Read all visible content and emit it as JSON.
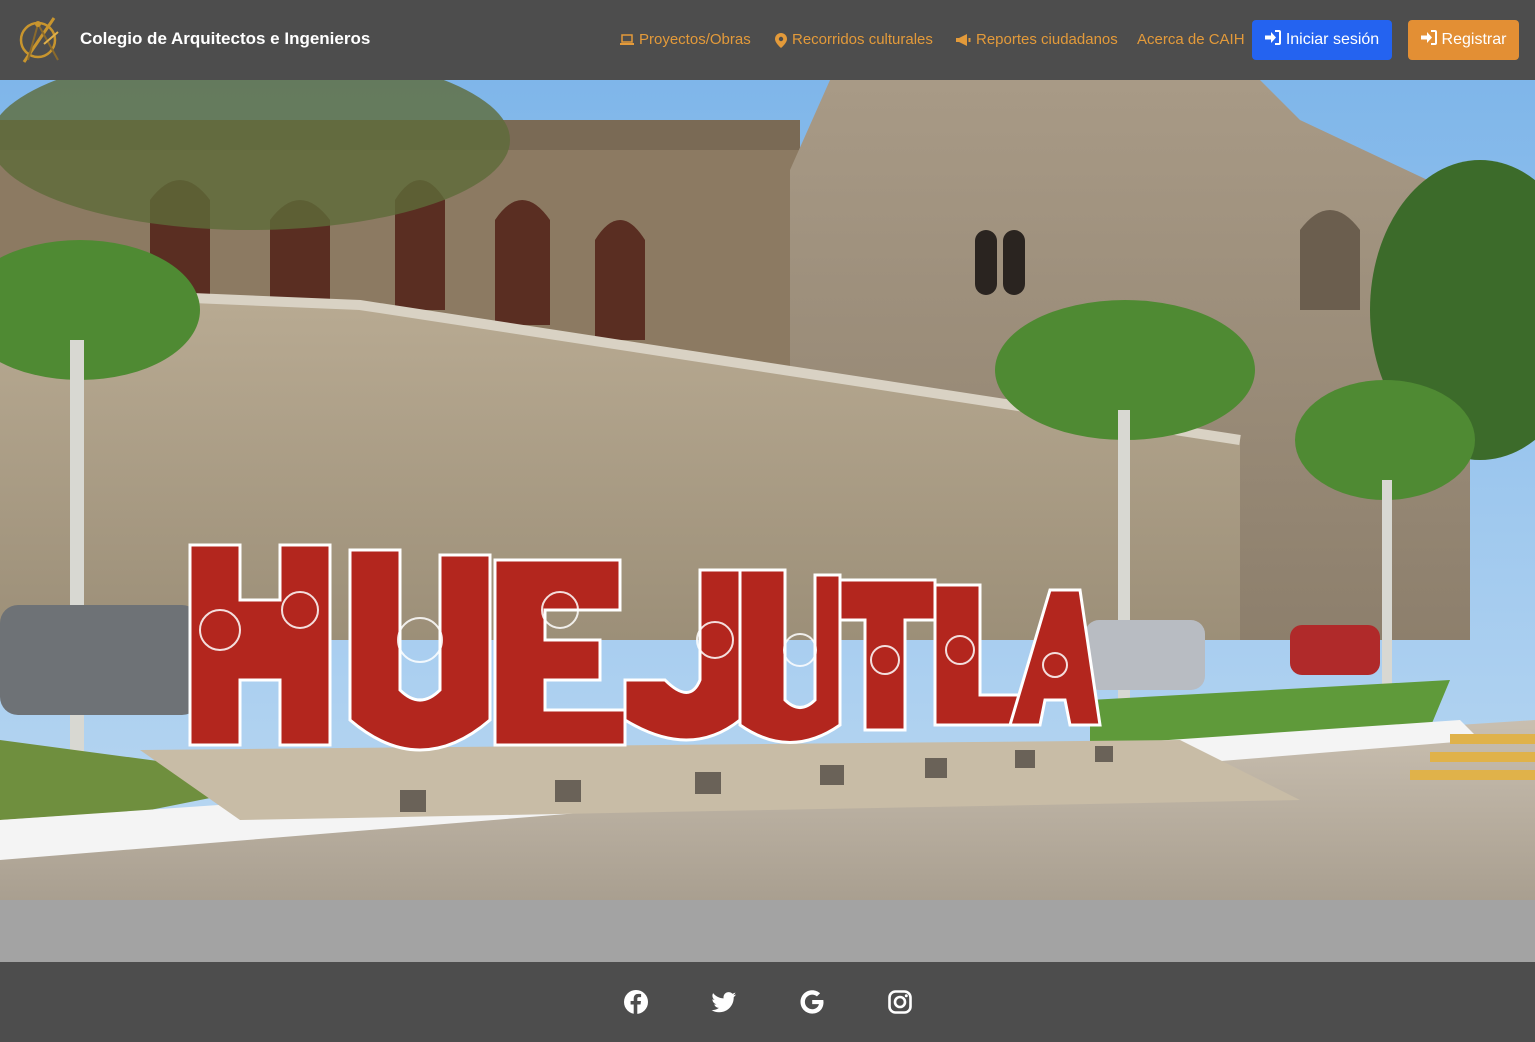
{
  "navbar": {
    "brand_title": "Colegio de Arquitectos e Ingenieros",
    "logo_icon": "compass-logo",
    "links": [
      {
        "label": "Proyectos/Obras",
        "icon": "laptop-icon"
      },
      {
        "label": "Recorridos culturales",
        "icon": "map-pin-icon"
      },
      {
        "label": "Reportes ciudadanos",
        "icon": "bullhorn-icon"
      },
      {
        "label": "Acerca de CAIH",
        "icon": ""
      }
    ],
    "login_label": "Iniciar sesión",
    "register_label": "Registrar"
  },
  "hero": {
    "image": "photo of colorful red-and-white HUEJUTLA town letters in front of a stone convent wall with palm trees",
    "letters": "HUEJUTLA"
  },
  "footer": {
    "social": [
      "facebook-icon",
      "twitter-icon",
      "google-icon",
      "instagram-icon"
    ]
  },
  "colors": {
    "navbar_bg": "#4d4d4d",
    "link_orange": "#e39a3a",
    "login_blue": "#2463f0",
    "register_orange": "#e38f34",
    "band_gray": "#a3a3a3"
  }
}
